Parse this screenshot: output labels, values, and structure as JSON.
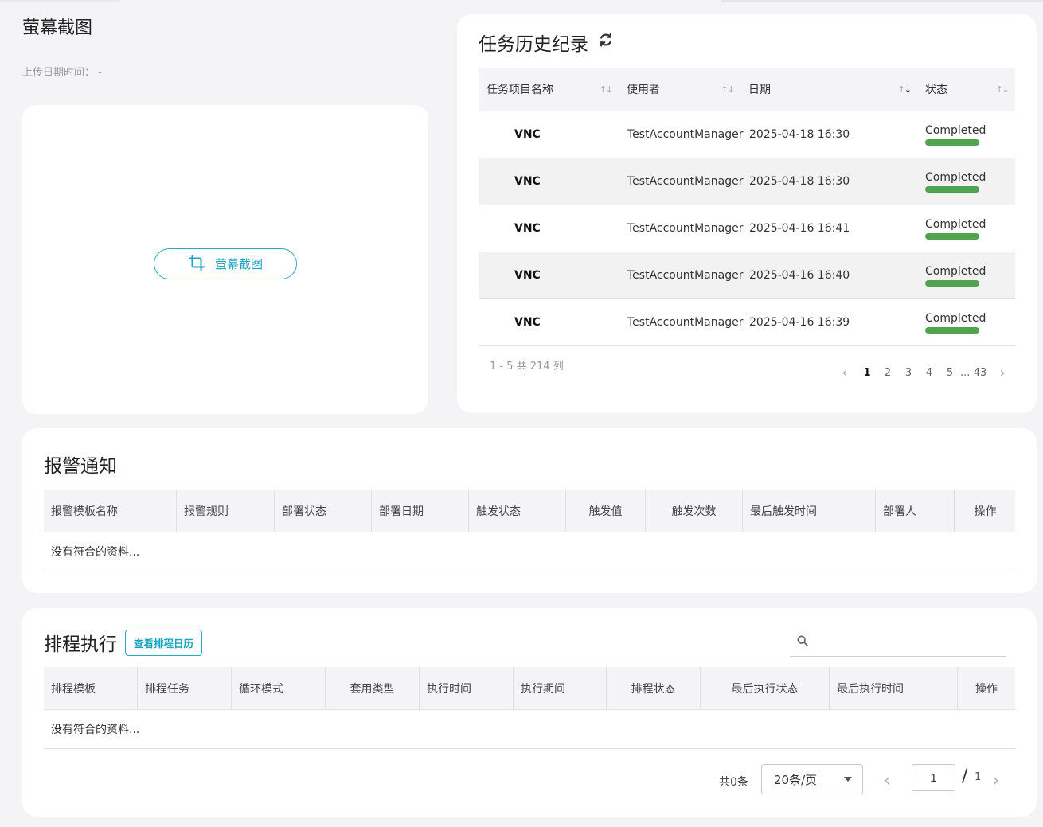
{
  "screenshot": {
    "title": "萤幕截图",
    "upload_label": "上传日期时间：",
    "upload_value": "-",
    "button_label": "萤幕截图"
  },
  "history": {
    "title": "任务历史纪录",
    "columns": [
      "任务项目名称",
      "使用者",
      "日期",
      "状态"
    ],
    "rows": [
      {
        "name": "VNC",
        "user": "TestAccountManager",
        "date": "2025-04-18 16:30",
        "status": "Completed"
      },
      {
        "name": "VNC",
        "user": "TestAccountManager",
        "date": "2025-04-18 16:30",
        "status": "Completed"
      },
      {
        "name": "VNC",
        "user": "TestAccountManager",
        "date": "2025-04-16 16:41",
        "status": "Completed"
      },
      {
        "name": "VNC",
        "user": "TestAccountManager",
        "date": "2025-04-16 16:40",
        "status": "Completed"
      },
      {
        "name": "VNC",
        "user": "TestAccountManager",
        "date": "2025-04-16 16:39",
        "status": "Completed"
      }
    ],
    "range_text": "1 - 5 共 214 列",
    "pages": [
      "1",
      "2",
      "3",
      "4",
      "5"
    ],
    "ellipsis": "...",
    "last_page": "43",
    "status_color": "#52a34f"
  },
  "alarm": {
    "title": "报警通知",
    "columns": [
      "报警模板名称",
      "报警规则",
      "部署状态",
      "部署日期",
      "触发状态",
      "触发值",
      "触发次数",
      "最后触发时间",
      "部署人",
      "操作"
    ],
    "empty_text": "没有符合的资料..."
  },
  "schedule": {
    "title": "排程执行",
    "calendar_button": "查看排程日历",
    "search_placeholder": "",
    "columns": [
      "排程模板",
      "排程任务",
      "循环模式",
      "套用类型",
      "执行时间",
      "执行期间",
      "排程状态",
      "最后执行状态",
      "最后执行时间",
      "操作"
    ],
    "empty_text": "没有符合的资料...",
    "total_text": "共0条",
    "page_size": "20条/页",
    "current_page": "1",
    "total_pages": "1"
  },
  "accent_color": "#26aac4"
}
